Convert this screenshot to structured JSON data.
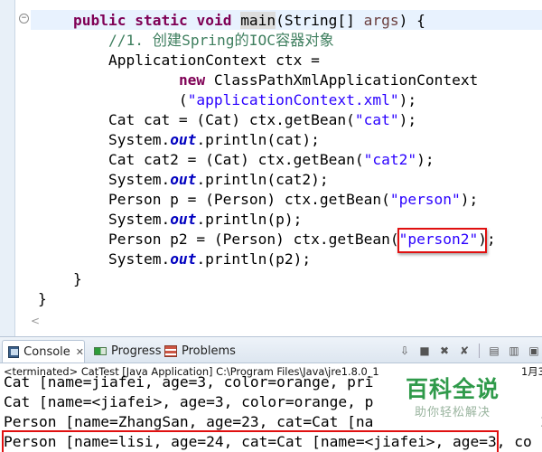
{
  "editor": {
    "lines": [
      [
        {
          "t": "    "
        },
        {
          "t": "public",
          "c": "kw"
        },
        {
          "t": " "
        },
        {
          "t": "static",
          "c": "kw"
        },
        {
          "t": " "
        },
        {
          "t": "void",
          "c": "kw"
        },
        {
          "t": " "
        },
        {
          "t": "main",
          "c": "mname"
        },
        {
          "t": "(String[] "
        },
        {
          "t": "args",
          "c": "pname"
        },
        {
          "t": ") {"
        }
      ],
      [
        {
          "t": "        "
        },
        {
          "t": "//1. 创建Spring的IOC容器对象",
          "c": "cm"
        }
      ],
      [
        {
          "t": "        ApplicationContext ctx ="
        }
      ],
      [
        {
          "t": "                "
        },
        {
          "t": "new",
          "c": "kw"
        },
        {
          "t": " ClassPathXmlApplicationContext"
        }
      ],
      [
        {
          "t": "                ("
        },
        {
          "t": "\"applicationContext.xml\"",
          "c": "str"
        },
        {
          "t": ");"
        }
      ],
      [
        {
          "t": "        Cat cat = (Cat) ctx.getBean("
        },
        {
          "t": "\"cat\"",
          "c": "str"
        },
        {
          "t": ");"
        }
      ],
      [
        {
          "t": "        System."
        },
        {
          "t": "out",
          "c": "fld"
        },
        {
          "t": ".println(cat);"
        }
      ],
      [
        {
          "t": "        Cat cat2 = (Cat) ctx.getBean("
        },
        {
          "t": "\"cat2\"",
          "c": "str"
        },
        {
          "t": ");"
        }
      ],
      [
        {
          "t": "        System."
        },
        {
          "t": "out",
          "c": "fld"
        },
        {
          "t": ".println(cat2);"
        }
      ],
      [
        {
          "t": "        Person p = (Person) ctx.getBean("
        },
        {
          "t": "\"person\"",
          "c": "str"
        },
        {
          "t": ");"
        }
      ],
      [
        {
          "t": "        System."
        },
        {
          "t": "out",
          "c": "fld"
        },
        {
          "t": ".println(p);"
        }
      ],
      [
        {
          "t": "        Person p2 = (Person) ctx.getBean("
        },
        {
          "t": "\"person2\"",
          "c": "str"
        },
        {
          "t": ");"
        }
      ],
      [
        {
          "t": "        System."
        },
        {
          "t": "out",
          "c": "fld"
        },
        {
          "t": ".println(p2);"
        }
      ],
      [
        {
          "t": "    }"
        }
      ],
      [
        {
          "t": "}"
        }
      ]
    ]
  },
  "console": {
    "tabs": {
      "console": "Console",
      "close": "✕",
      "progress": "Progress",
      "problems": "Problems"
    },
    "toolbar": [
      "view-menu-icon",
      "terminate-icon",
      "remove-launch-icon",
      "remove-all-icon",
      "scroll-lock-icon",
      "pin-console-icon",
      "display-console-icon"
    ],
    "status": "<terminated> CatTest [Java Application] C:\\Program Files\\Java\\jre1.8.0_1",
    "status_right": "1月3",
    "output": [
      "Cat [name=jiafei, age=3, color=orange, pri",
      "Cat [name=<jiafei>, age=3, color=orange, p",
      "Person [name=ZhangSan, age=23, cat=Cat [na                   2,",
      "Person [name=lisi, age=24, cat=Cat [name=<jiafei>, age=3, co"
    ]
  },
  "watermark": {
    "title": "百科全说",
    "subtitle": "助你轻松解决"
  },
  "colors": {
    "keyword": "#7f0055",
    "comment": "#3f7f5f",
    "string": "#2a00ff",
    "field": "#0000c0",
    "highlight_box": "#e01010",
    "watermark_green": "#2f9a4a"
  }
}
